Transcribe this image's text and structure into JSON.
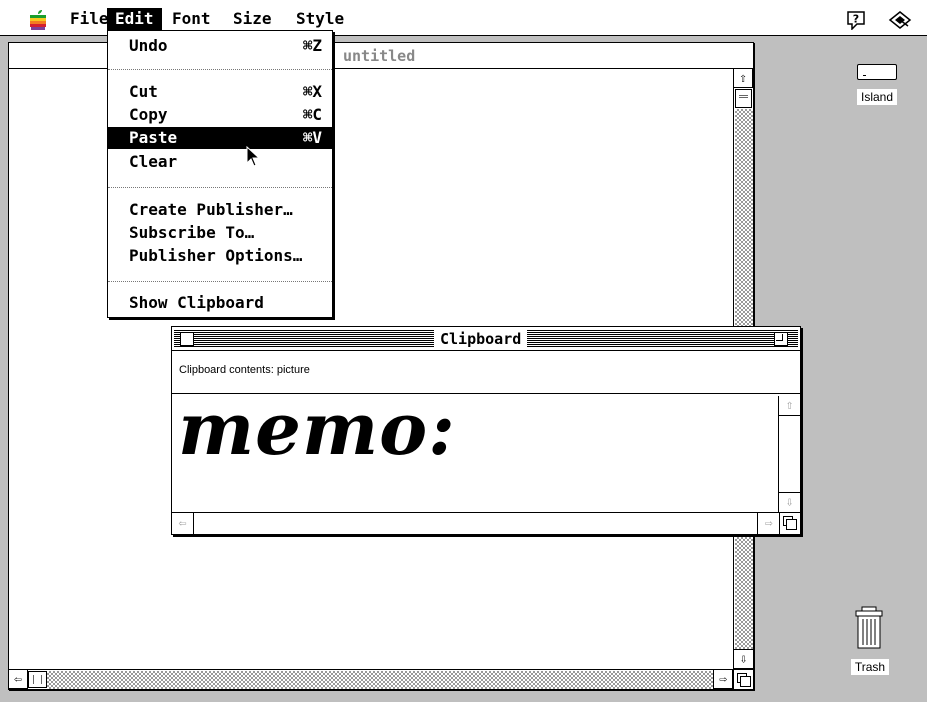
{
  "menubar": {
    "items": [
      {
        "label": "File"
      },
      {
        "label": "Edit"
      },
      {
        "label": "Font"
      },
      {
        "label": "Size"
      },
      {
        "label": "Style"
      }
    ],
    "help_icon": "help-icon",
    "app_icon": "application-icon"
  },
  "doc_window": {
    "title": "untitled"
  },
  "edit_menu": {
    "items": [
      {
        "label": "Undo",
        "shortcut": "⌘Z"
      },
      {
        "label": "Cut",
        "shortcut": "⌘X"
      },
      {
        "label": "Copy",
        "shortcut": "⌘C"
      },
      {
        "label": "Paste",
        "shortcut": "⌘V"
      },
      {
        "label": "Clear",
        "shortcut": ""
      },
      {
        "label": "Create Publisher…",
        "shortcut": ""
      },
      {
        "label": "Subscribe To…",
        "shortcut": ""
      },
      {
        "label": "Publisher Options…",
        "shortcut": ""
      },
      {
        "label": "Show Clipboard",
        "shortcut": ""
      }
    ],
    "highlighted": "Paste"
  },
  "clipboard": {
    "title": "Clipboard",
    "info": "Clipboard contents:  picture",
    "picture_text": "memo:"
  },
  "desktop": {
    "disk_label": "Island",
    "trash_label": "Trash"
  }
}
